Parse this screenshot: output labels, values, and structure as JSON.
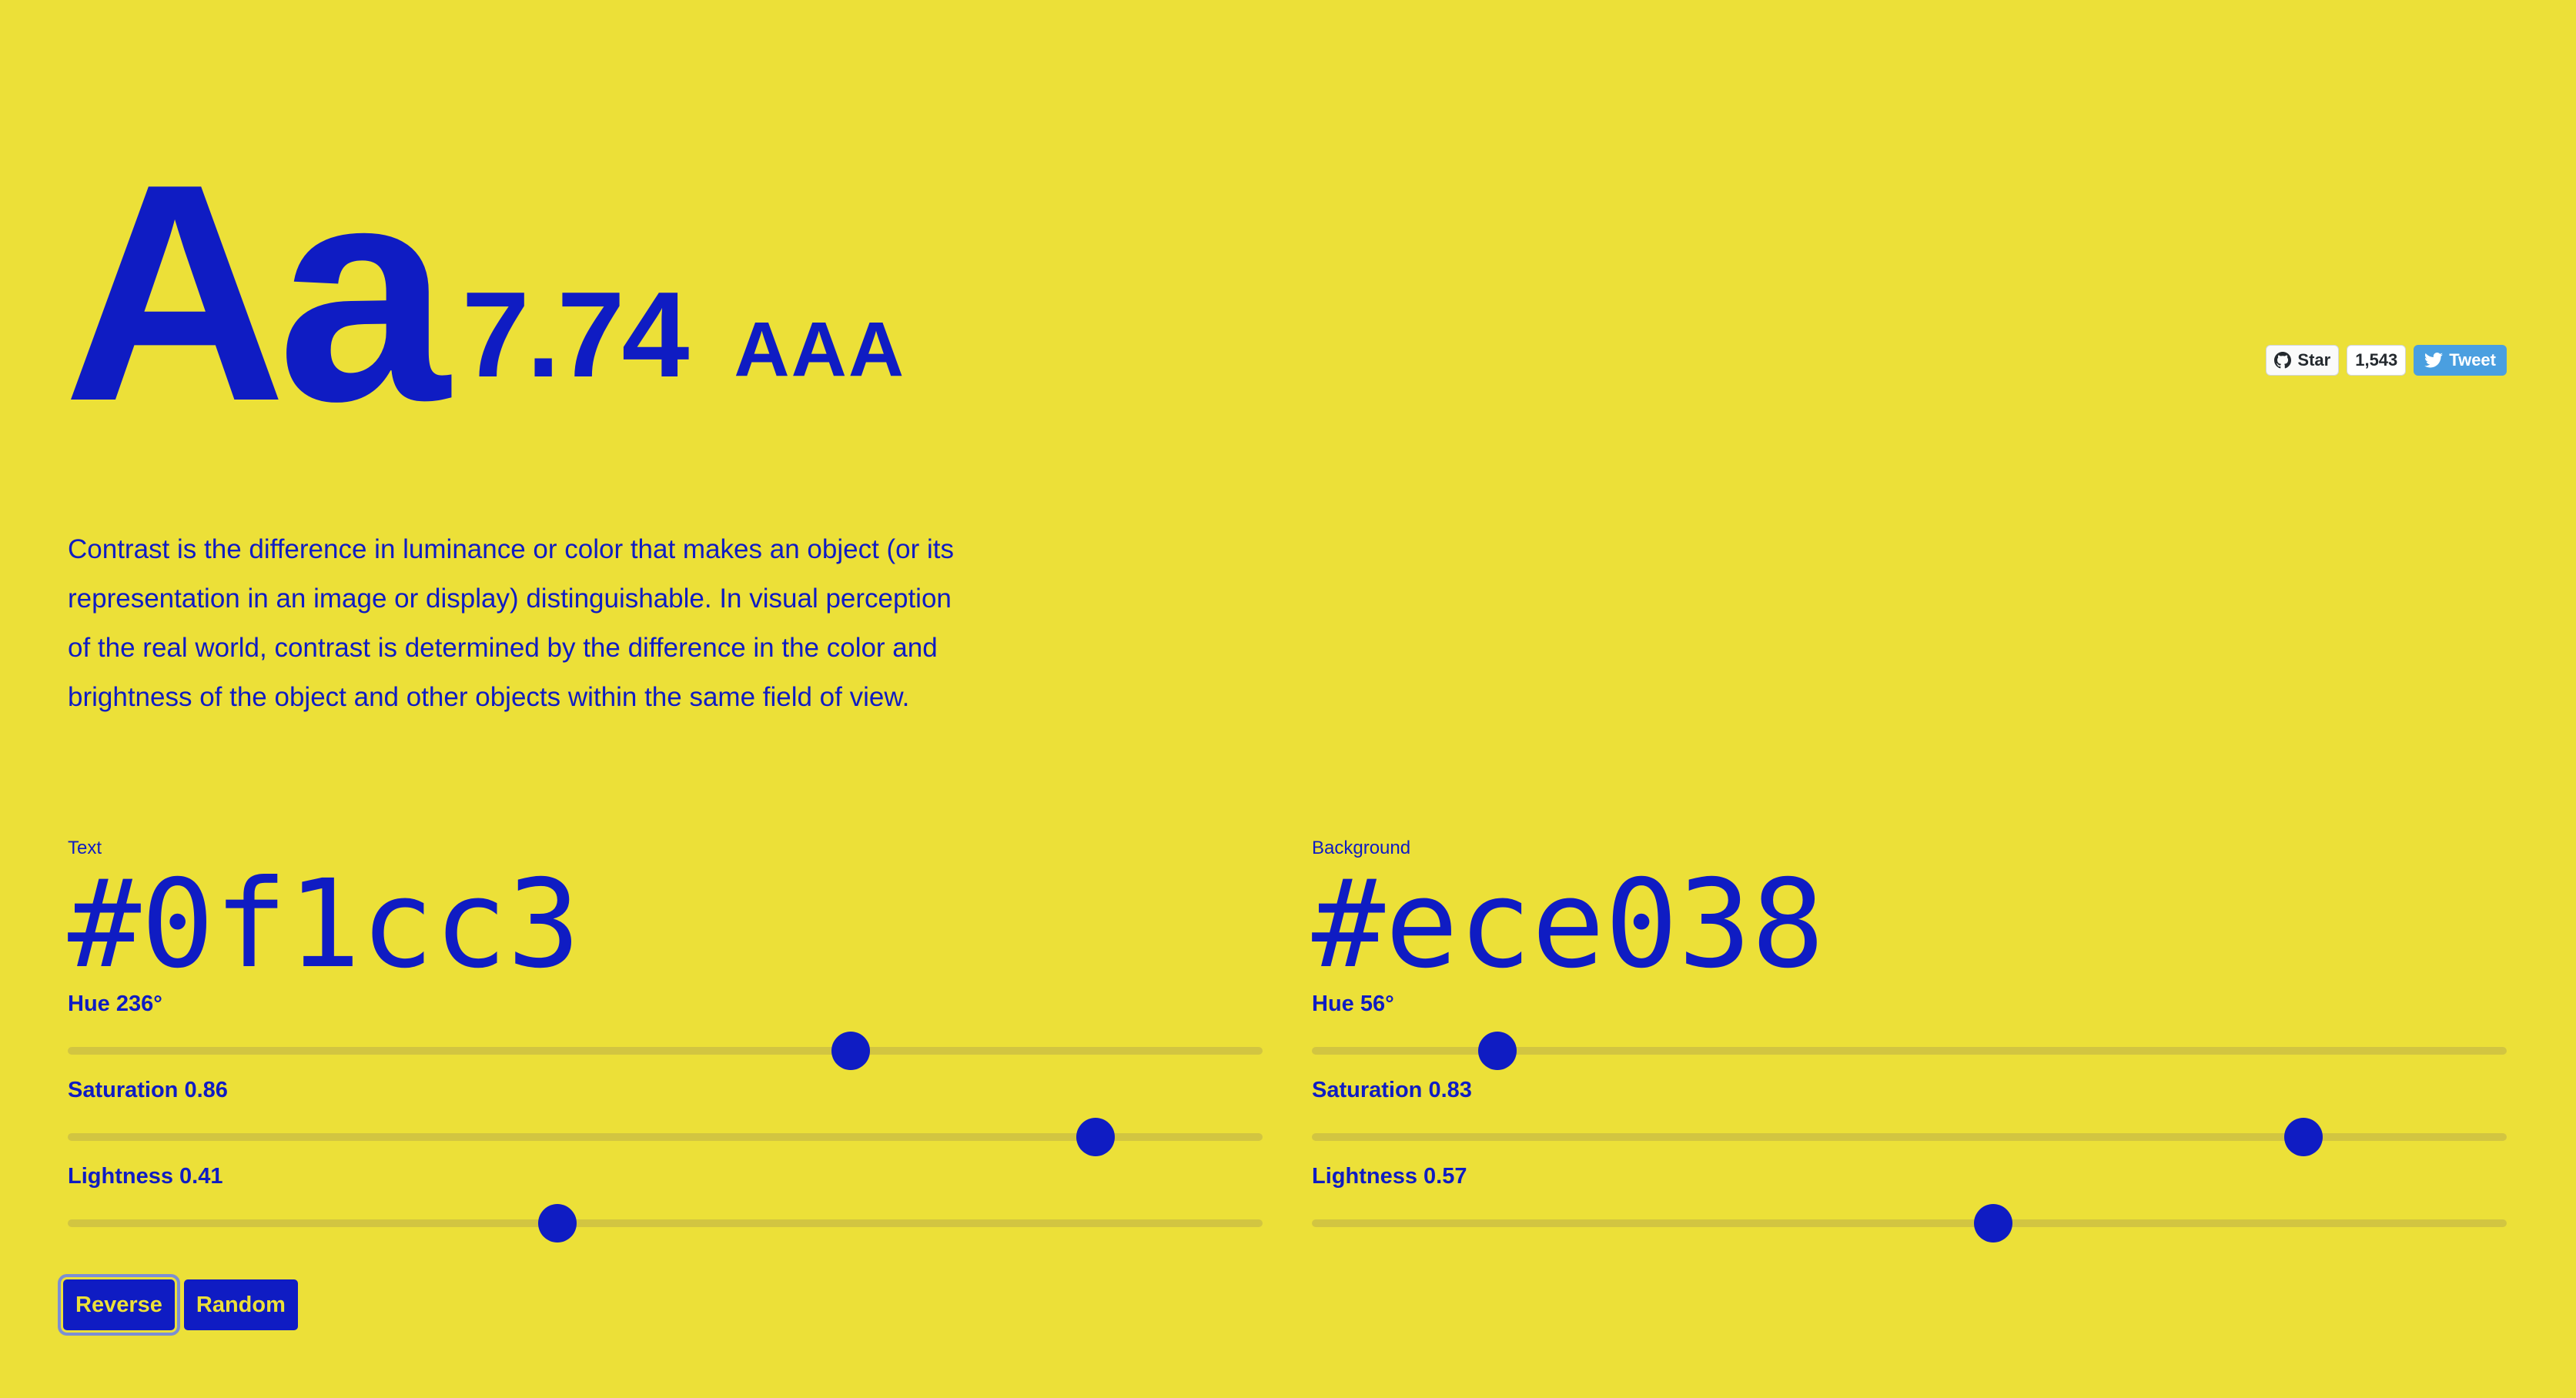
{
  "hero": {
    "sample": "Aa",
    "ratio": "7.74",
    "level": "AAA"
  },
  "social": {
    "star_label": "Star",
    "star_count": "1,543",
    "tweet_label": "Tweet"
  },
  "description": "Contrast is the difference in luminance or color that makes an object (or its representation in an image or display) distinguishable. In visual perception of the real world, contrast is determined by the difference in the color and brightness of the object and other objects within the same field of view.",
  "colors": {
    "text": "#0f1cc3",
    "background": "#ece038"
  },
  "text_panel": {
    "label": "Text",
    "hex": "#0f1cc3",
    "hue_label": "Hue 236°",
    "hue_value": 236,
    "saturation_label": "Saturation 0.86",
    "saturation_value": 0.86,
    "lightness_label": "Lightness 0.41",
    "lightness_value": 0.41
  },
  "bg_panel": {
    "label": "Background",
    "hex": "#ece038",
    "hue_label": "Hue 56°",
    "hue_value": 56,
    "saturation_label": "Saturation 0.83",
    "saturation_value": 0.83,
    "lightness_label": "Lightness 0.57",
    "lightness_value": 0.57
  },
  "buttons": {
    "reverse": "Reverse",
    "random": "Random"
  }
}
